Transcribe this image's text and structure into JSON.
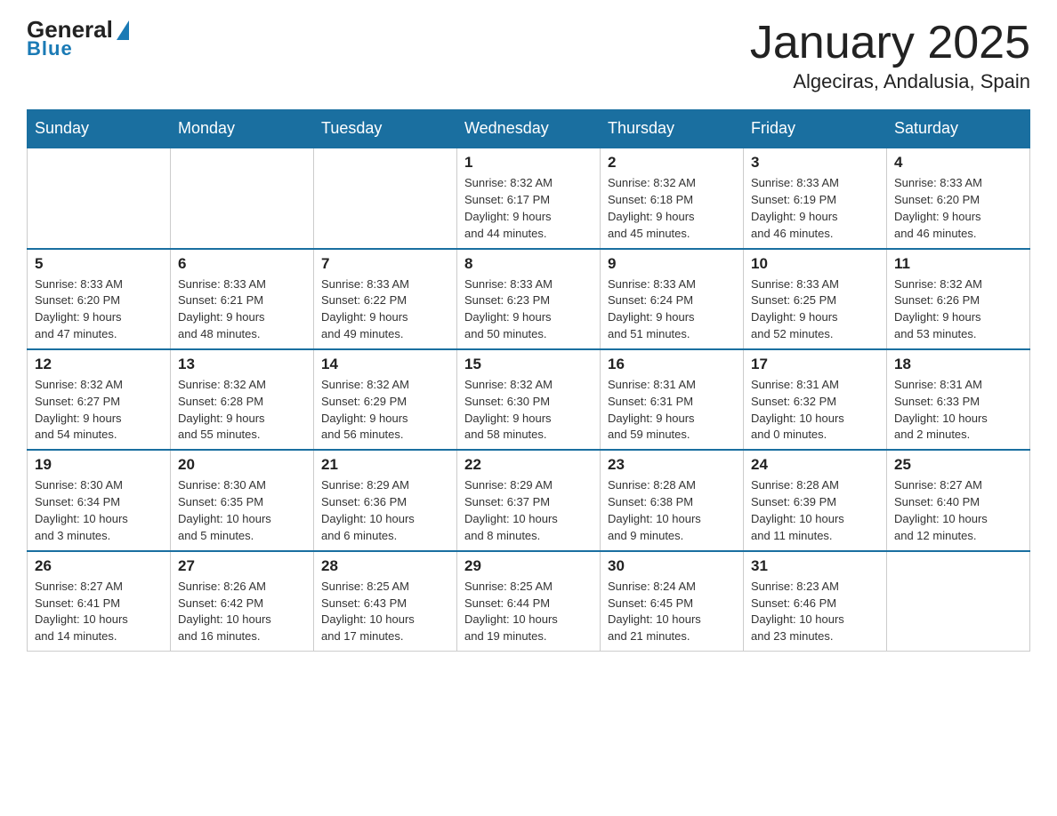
{
  "header": {
    "logo_general": "General",
    "logo_blue": "Blue",
    "month_title": "January 2025",
    "location": "Algeciras, Andalusia, Spain"
  },
  "days_of_week": [
    "Sunday",
    "Monday",
    "Tuesday",
    "Wednesday",
    "Thursday",
    "Friday",
    "Saturday"
  ],
  "weeks": [
    [
      {
        "day": "",
        "info": ""
      },
      {
        "day": "",
        "info": ""
      },
      {
        "day": "",
        "info": ""
      },
      {
        "day": "1",
        "info": "Sunrise: 8:32 AM\nSunset: 6:17 PM\nDaylight: 9 hours\nand 44 minutes."
      },
      {
        "day": "2",
        "info": "Sunrise: 8:32 AM\nSunset: 6:18 PM\nDaylight: 9 hours\nand 45 minutes."
      },
      {
        "day": "3",
        "info": "Sunrise: 8:33 AM\nSunset: 6:19 PM\nDaylight: 9 hours\nand 46 minutes."
      },
      {
        "day": "4",
        "info": "Sunrise: 8:33 AM\nSunset: 6:20 PM\nDaylight: 9 hours\nand 46 minutes."
      }
    ],
    [
      {
        "day": "5",
        "info": "Sunrise: 8:33 AM\nSunset: 6:20 PM\nDaylight: 9 hours\nand 47 minutes."
      },
      {
        "day": "6",
        "info": "Sunrise: 8:33 AM\nSunset: 6:21 PM\nDaylight: 9 hours\nand 48 minutes."
      },
      {
        "day": "7",
        "info": "Sunrise: 8:33 AM\nSunset: 6:22 PM\nDaylight: 9 hours\nand 49 minutes."
      },
      {
        "day": "8",
        "info": "Sunrise: 8:33 AM\nSunset: 6:23 PM\nDaylight: 9 hours\nand 50 minutes."
      },
      {
        "day": "9",
        "info": "Sunrise: 8:33 AM\nSunset: 6:24 PM\nDaylight: 9 hours\nand 51 minutes."
      },
      {
        "day": "10",
        "info": "Sunrise: 8:33 AM\nSunset: 6:25 PM\nDaylight: 9 hours\nand 52 minutes."
      },
      {
        "day": "11",
        "info": "Sunrise: 8:32 AM\nSunset: 6:26 PM\nDaylight: 9 hours\nand 53 minutes."
      }
    ],
    [
      {
        "day": "12",
        "info": "Sunrise: 8:32 AM\nSunset: 6:27 PM\nDaylight: 9 hours\nand 54 minutes."
      },
      {
        "day": "13",
        "info": "Sunrise: 8:32 AM\nSunset: 6:28 PM\nDaylight: 9 hours\nand 55 minutes."
      },
      {
        "day": "14",
        "info": "Sunrise: 8:32 AM\nSunset: 6:29 PM\nDaylight: 9 hours\nand 56 minutes."
      },
      {
        "day": "15",
        "info": "Sunrise: 8:32 AM\nSunset: 6:30 PM\nDaylight: 9 hours\nand 58 minutes."
      },
      {
        "day": "16",
        "info": "Sunrise: 8:31 AM\nSunset: 6:31 PM\nDaylight: 9 hours\nand 59 minutes."
      },
      {
        "day": "17",
        "info": "Sunrise: 8:31 AM\nSunset: 6:32 PM\nDaylight: 10 hours\nand 0 minutes."
      },
      {
        "day": "18",
        "info": "Sunrise: 8:31 AM\nSunset: 6:33 PM\nDaylight: 10 hours\nand 2 minutes."
      }
    ],
    [
      {
        "day": "19",
        "info": "Sunrise: 8:30 AM\nSunset: 6:34 PM\nDaylight: 10 hours\nand 3 minutes."
      },
      {
        "day": "20",
        "info": "Sunrise: 8:30 AM\nSunset: 6:35 PM\nDaylight: 10 hours\nand 5 minutes."
      },
      {
        "day": "21",
        "info": "Sunrise: 8:29 AM\nSunset: 6:36 PM\nDaylight: 10 hours\nand 6 minutes."
      },
      {
        "day": "22",
        "info": "Sunrise: 8:29 AM\nSunset: 6:37 PM\nDaylight: 10 hours\nand 8 minutes."
      },
      {
        "day": "23",
        "info": "Sunrise: 8:28 AM\nSunset: 6:38 PM\nDaylight: 10 hours\nand 9 minutes."
      },
      {
        "day": "24",
        "info": "Sunrise: 8:28 AM\nSunset: 6:39 PM\nDaylight: 10 hours\nand 11 minutes."
      },
      {
        "day": "25",
        "info": "Sunrise: 8:27 AM\nSunset: 6:40 PM\nDaylight: 10 hours\nand 12 minutes."
      }
    ],
    [
      {
        "day": "26",
        "info": "Sunrise: 8:27 AM\nSunset: 6:41 PM\nDaylight: 10 hours\nand 14 minutes."
      },
      {
        "day": "27",
        "info": "Sunrise: 8:26 AM\nSunset: 6:42 PM\nDaylight: 10 hours\nand 16 minutes."
      },
      {
        "day": "28",
        "info": "Sunrise: 8:25 AM\nSunset: 6:43 PM\nDaylight: 10 hours\nand 17 minutes."
      },
      {
        "day": "29",
        "info": "Sunrise: 8:25 AM\nSunset: 6:44 PM\nDaylight: 10 hours\nand 19 minutes."
      },
      {
        "day": "30",
        "info": "Sunrise: 8:24 AM\nSunset: 6:45 PM\nDaylight: 10 hours\nand 21 minutes."
      },
      {
        "day": "31",
        "info": "Sunrise: 8:23 AM\nSunset: 6:46 PM\nDaylight: 10 hours\nand 23 minutes."
      },
      {
        "day": "",
        "info": ""
      }
    ]
  ]
}
